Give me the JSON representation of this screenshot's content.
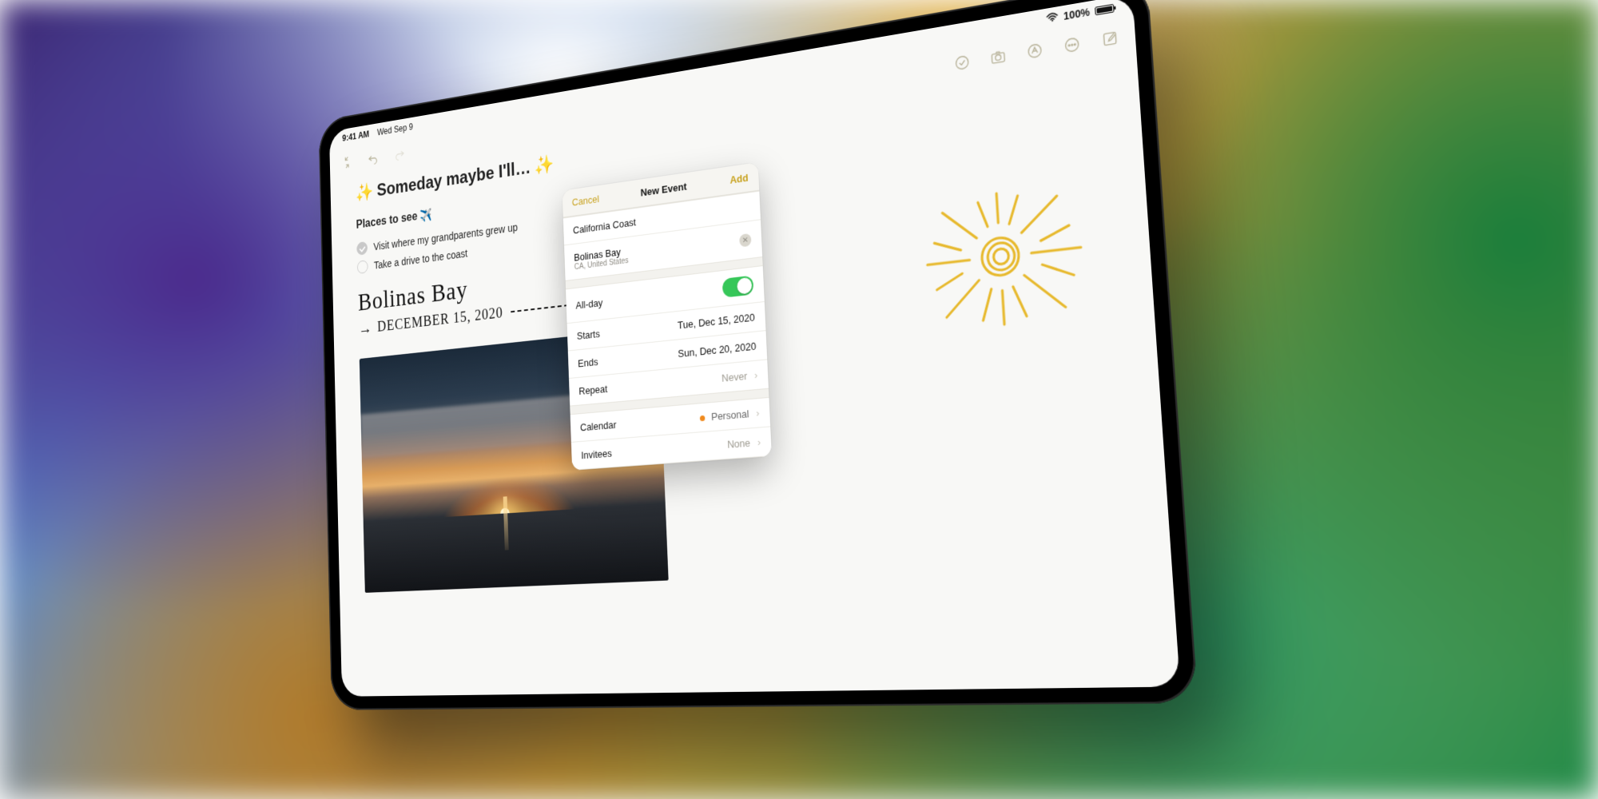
{
  "status": {
    "time": "9:41 AM",
    "date": "Wed Sep 9",
    "battery": "100%"
  },
  "note": {
    "title": "Someday maybe I'll…",
    "section": "Places to see",
    "items": [
      {
        "done": true,
        "text": "Visit where my grandparents grew up"
      },
      {
        "done": false,
        "text": "Take a drive to the coast"
      }
    ],
    "hand_title": "Bolinas Bay",
    "hand_date": "DECEMBER 15, 2020"
  },
  "popover": {
    "cancel": "Cancel",
    "title": "New Event",
    "add": "Add",
    "event_title": "California Coast",
    "location": "Bolinas Bay",
    "location_sub": "CA, United States",
    "allday": "All-day",
    "starts_lbl": "Starts",
    "starts_val": "Tue, Dec 15, 2020",
    "ends_lbl": "Ends",
    "ends_val": "Sun, Dec 20, 2020",
    "repeat_lbl": "Repeat",
    "repeat_val": "Never",
    "calendar_lbl": "Calendar",
    "calendar_val": "Personal",
    "invitees_lbl": "Invitees",
    "invitees_val": "None"
  }
}
